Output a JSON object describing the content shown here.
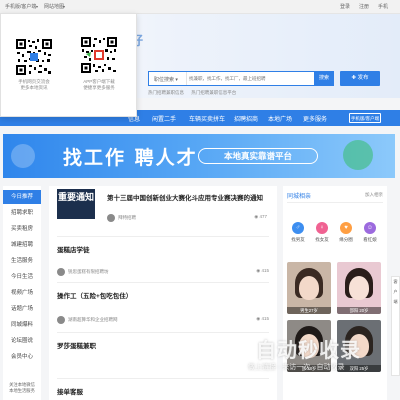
{
  "topbar": {
    "mobile_label": "手机版/客户端",
    "sitemap_label": "网站地图",
    "login_label": "登录",
    "register_label": "注册",
    "phone_label": "手机"
  },
  "qr_panel": {
    "left_caption_1": "手机网页交流会",
    "left_caption_2": "更多本地资讯",
    "right_caption_1": "APP客户端下载",
    "right_caption_2": "便捷享更多服务"
  },
  "header": {
    "logo_text": "美好",
    "search_category": "职位搜索",
    "search_placeholder": "找兼职，找工作，找工厂，最上班招聘",
    "search_button": "搜索",
    "publish_button": "发布",
    "hotwords": [
      "热门招聘兼职信息",
      "热门招聘兼职信息平台"
    ]
  },
  "nav": {
    "items": [
      "闲置二手",
      "车辆买卖拼车",
      "招聘招商",
      "本地广场",
      "更多服务"
    ],
    "active_partial": "信息",
    "mobile_button": "手机版/客户端"
  },
  "banner": {
    "main": "找工作  聘人才",
    "sub": "本地真实靠谱平台"
  },
  "leftmenu": {
    "items": [
      "今日推荐",
      "招聘求职",
      "买卖租房",
      "城建招聘",
      "生活服务",
      "今日生活",
      "视频广场",
      "话题广场",
      "同城爆料",
      "论坛圈说",
      "会员中心"
    ],
    "footer_1": "关注本地微信",
    "footer_2": "本地生活服务"
  },
  "feed": {
    "posts": [
      {
        "title": "第十三届中国创新创业大赛化斗应用专业赛决赛的通知",
        "author": "拜特招聘",
        "views": "477"
      },
      {
        "title": "蛋糕店学徒",
        "author": "锐思蛋糕有限招聘坊",
        "views": "415"
      },
      {
        "title": "操作工（五险+包吃包住）",
        "author": "湖南超算华和企业招聘网",
        "views": "415"
      },
      {
        "title": "罗莎蛋糕兼职",
        "author": "",
        "views": ""
      },
      {
        "title": "接单客服",
        "author": "",
        "views": ""
      }
    ],
    "notice_text": "重要通知"
  },
  "rightpanel": {
    "title": "同城相亲",
    "more": "加入相亲",
    "categories": [
      "找男友",
      "找女友",
      "缘分圈",
      "看红娘"
    ],
    "photos": [
      "男生27岁",
      "邵阳 20岁",
      "邵 28岁",
      "双阳 25岁"
    ]
  },
  "float_panel": [
    "客",
    "户",
    "端"
  ],
  "watermark": {
    "main": "自动秒收录",
    "sub": "做上链接 · 来访一次 · 自动收录"
  },
  "colors": {
    "primary": "#2f7fe6",
    "nav_active": "#1e63c4"
  }
}
